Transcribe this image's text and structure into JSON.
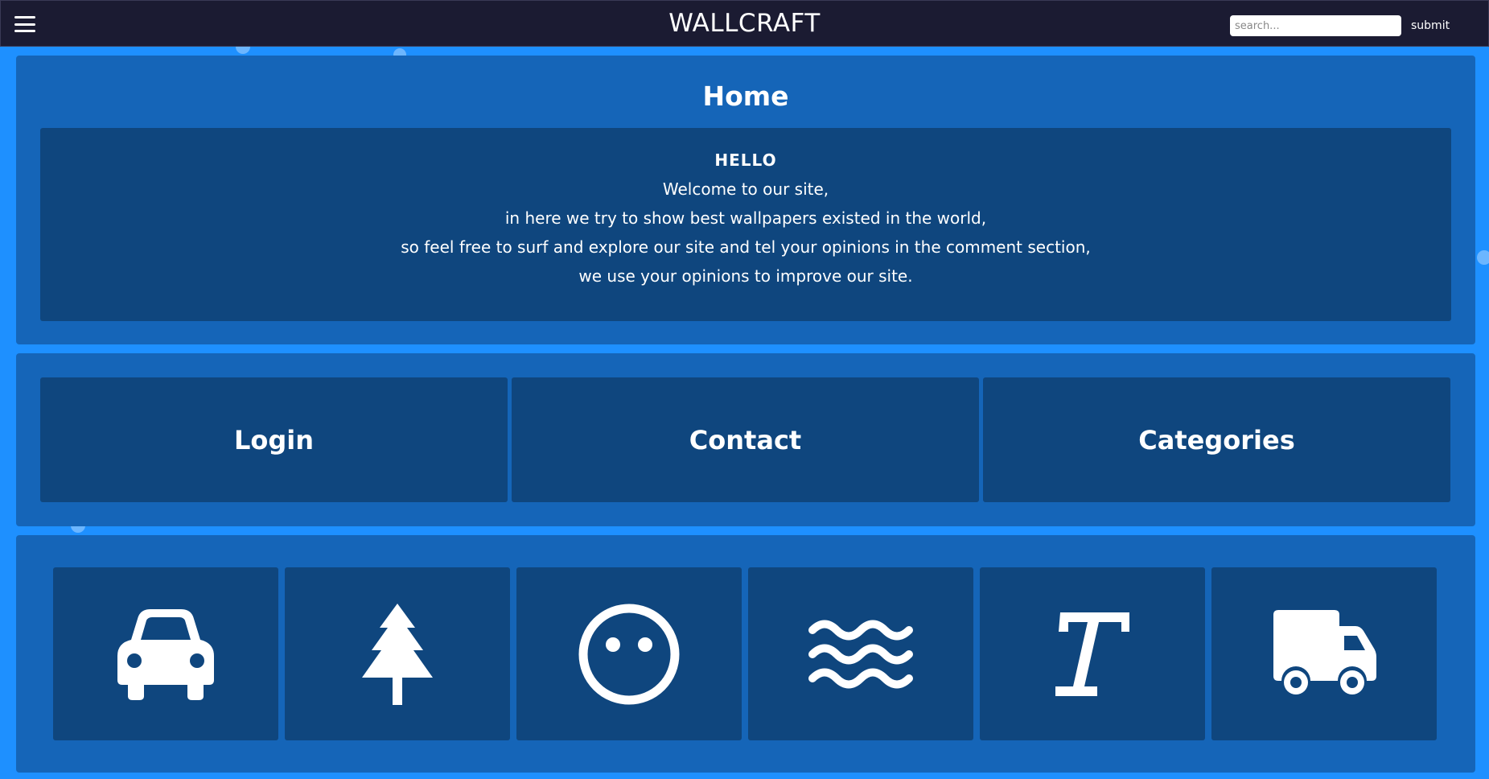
{
  "navbar": {
    "brand": "WALLCRAFT",
    "menu_icon": "hamburger-menu-icon",
    "search": {
      "placeholder": "search...",
      "value": ""
    },
    "submit_label": "submit"
  },
  "home": {
    "title": "Home",
    "greeting": "HELLO",
    "lines": [
      "Welcome to our site,",
      "in here we try to show best wallpapers existed in the world,",
      "so feel free to surf and explore our site and tel your opinions in the comment section,",
      "we use your opinions to improve our site."
    ]
  },
  "links": [
    {
      "label": "Login"
    },
    {
      "label": "Contact"
    },
    {
      "label": "Categories"
    }
  ],
  "categories": [
    {
      "icon": "car-icon"
    },
    {
      "icon": "tree-icon"
    },
    {
      "icon": "face-icon"
    },
    {
      "icon": "water-icon"
    },
    {
      "icon": "text-icon"
    },
    {
      "icon": "truck-icon"
    }
  ],
  "colors": {
    "page_background": "#1e90ff",
    "navbar_background": "#1b1b32",
    "panel": "#1565b8",
    "card": "#0f467e",
    "text": "#ffffff"
  }
}
